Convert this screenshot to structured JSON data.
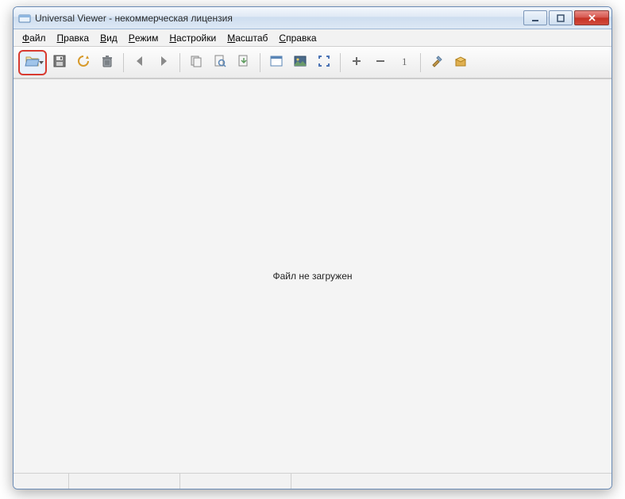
{
  "window": {
    "title": "Universal Viewer - некоммерческая лицензия"
  },
  "menu": {
    "items": [
      {
        "prefix": "",
        "accel": "Ф",
        "rest": "айл"
      },
      {
        "prefix": "",
        "accel": "П",
        "rest": "равка"
      },
      {
        "prefix": "",
        "accel": "В",
        "rest": "ид"
      },
      {
        "prefix": "",
        "accel": "Р",
        "rest": "ежим"
      },
      {
        "prefix": "",
        "accel": "Н",
        "rest": "астройки"
      },
      {
        "prefix": "",
        "accel": "М",
        "rest": "асштаб"
      },
      {
        "prefix": "",
        "accel": "С",
        "rest": "правка"
      }
    ]
  },
  "content": {
    "placeholder": "Файл не загружен"
  }
}
